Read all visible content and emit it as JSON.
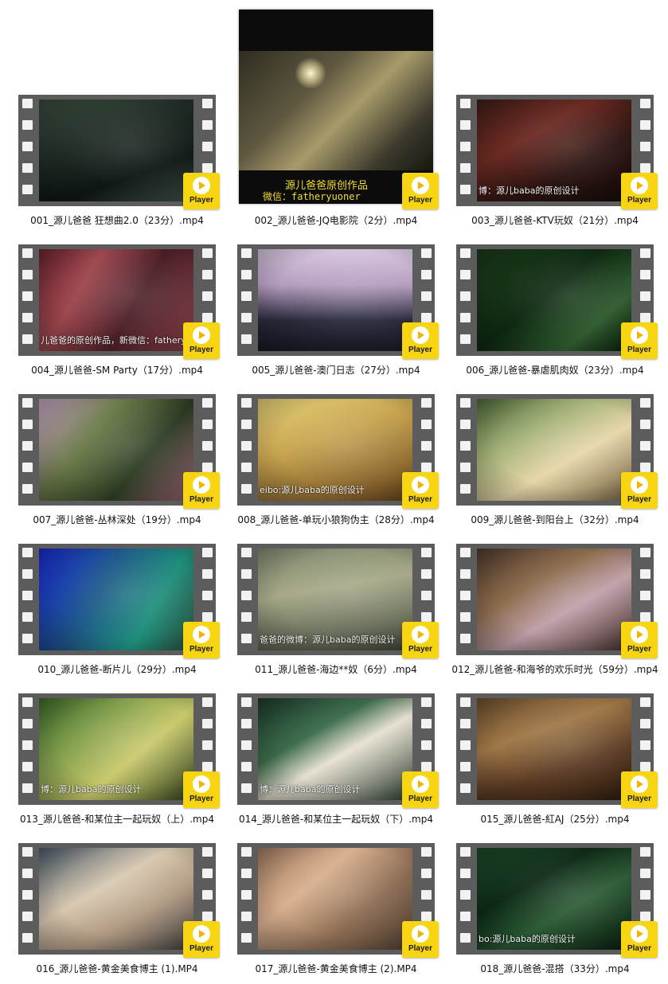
{
  "player_label": "Player",
  "player_icon": "play-icon",
  "player_color": "#f7d513",
  "items": [
    {
      "filename": "001_源儿爸爸 狂想曲2.0（23分）.mp4",
      "watermark": ""
    },
    {
      "filename": "002_源儿爸爸-JQ电影院（2分）.mp4",
      "watermark": ""
    },
    {
      "filename": "003_源儿爸爸-KTV玩奴（21分）.mp4",
      "watermark": "博：源儿baba的原创设计"
    },
    {
      "filename": "004_源儿爸爸-SM Party（17分）.mp4",
      "watermark": "儿爸爸的原创作品，新微信：fatheryuaner"
    },
    {
      "filename": "005_源儿爸爸-澳门日志（27分）.mp4",
      "watermark": ""
    },
    {
      "filename": "006_源儿爸爸-暴虐肌肉奴（23分）.mp4",
      "watermark": ""
    },
    {
      "filename": "007_源儿爸爸-丛林深处（19分）.mp4",
      "watermark": ""
    },
    {
      "filename": "008_源儿爸爸-单玩小狼狗伪主（28分）.mp4",
      "watermark": "eibo:源儿baba的原创设计"
    },
    {
      "filename": "009_源儿爸爸-到阳台上（32分）.mp4",
      "watermark": ""
    },
    {
      "filename": "010_源儿爸爸-断片儿（29分）.mp4",
      "watermark": ""
    },
    {
      "filename": "011_源儿爸爸-海边**奴（6分）.mp4",
      "watermark": "爸爸的微博：源儿baba的原创设计"
    },
    {
      "filename": "012_源儿爸爸-和海爷的欢乐时光（59分）.mp4",
      "watermark": ""
    },
    {
      "filename": "013_源儿爸爸-和某位主一起玩奴（上）.mp4",
      "watermark": "博：源儿baba的原创设计"
    },
    {
      "filename": "014_源儿爸爸-和某位主一起玩奴（下）.mp4",
      "watermark": "博：源儿baba的原创设计"
    },
    {
      "filename": "015_源儿爸爸-紅AJ（25分）.mp4",
      "watermark": ""
    },
    {
      "filename": "016_源儿爸爸-黄金美食博主 (1).MP4",
      "watermark": ""
    },
    {
      "filename": "017_源儿爸爸-黄金美食博主 (2).MP4",
      "watermark": ""
    },
    {
      "filename": "018_源儿爸爸-混搭（33分）.mp4",
      "watermark": "bo:源儿baba的原创设计"
    }
  ],
  "poster": {
    "line1": "源儿爸爸原创作品",
    "line2": "微信：fatheryuoner"
  }
}
